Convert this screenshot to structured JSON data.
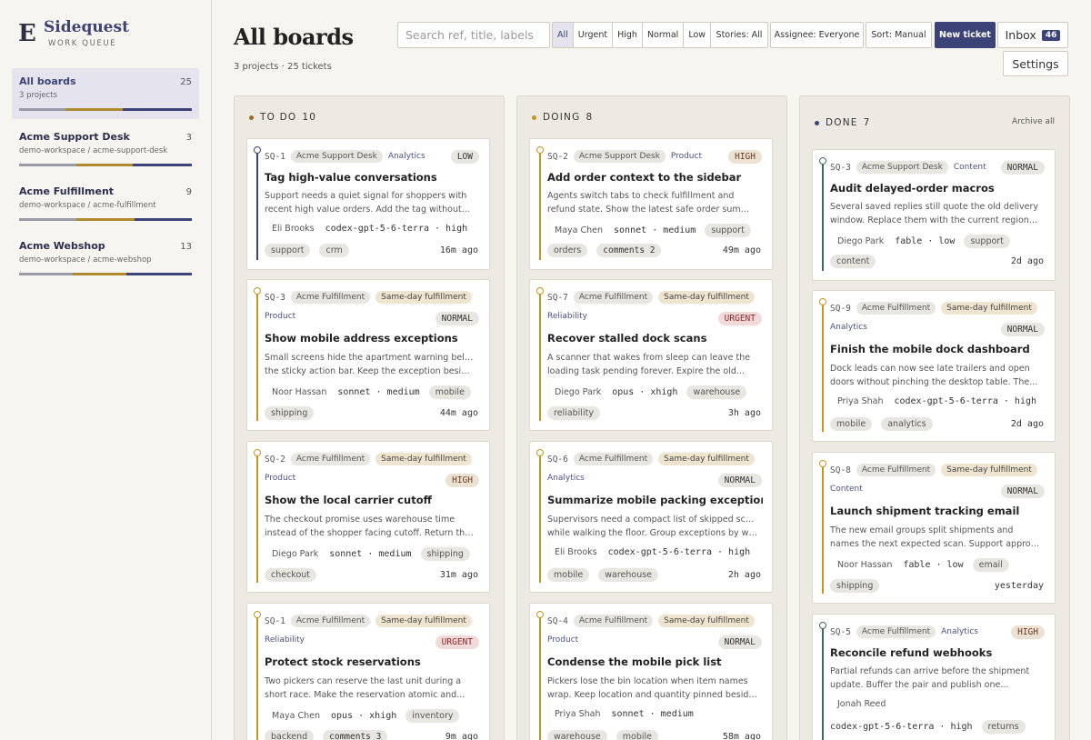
{
  "brand": {
    "name": "Sidequest",
    "subtitle": "WORK QUEUE",
    "mark": "E"
  },
  "sidebar": {
    "projects": [
      {
        "name": "All boards",
        "sub": "3 projects",
        "count": "25"
      },
      {
        "name": "Acme Support Desk",
        "sub": "demo-workspace / acme-support-desk",
        "count": "3"
      },
      {
        "name": "Acme Fulfillment",
        "sub": "demo-workspace / acme-fulfillment",
        "count": "9"
      },
      {
        "name": "Acme Webshop",
        "sub": "demo-workspace / acme-webshop",
        "count": "13"
      }
    ]
  },
  "header": {
    "title": "All boards",
    "subtitle": "3 projects · 25 tickets"
  },
  "toolbar": {
    "search_placeholder": "Search ref, title, labels",
    "filters": [
      "All",
      "Urgent",
      "High",
      "Normal",
      "Low"
    ],
    "stories": "Stories: All",
    "assignee": "Assignee: Everyone",
    "sort": "Sort: Manual",
    "new_ticket": "New ticket",
    "inbox": "Inbox",
    "inbox_count": "46",
    "settings": "Settings"
  },
  "colors": {
    "accent": "#3b4377",
    "todo": "#9a6a1e",
    "doing": "#c8951e",
    "done": "#3f6b52"
  },
  "columns": [
    {
      "title": "TO DO",
      "count": "10",
      "cards": [
        {
          "ref": "SQ-1",
          "project": "Acme Support Desk",
          "kind": "Analytics",
          "priority": "LOW",
          "title": "Tag high-value conversations",
          "desc1": "Support needs a quiet signal for shoppers with",
          "desc2": "recent high value orders. Add the tag without...",
          "assignee": "Eli Brooks",
          "model": "codex-gpt-5-6-terra · high",
          "tags": [
            "support",
            "crm"
          ],
          "ago": "16m ago"
        },
        {
          "ref": "SQ-3",
          "project": "Acme Fulfillment",
          "story": "Same-day fulfillment",
          "kind": "Product",
          "priority": "NORMAL",
          "title": "Show mobile address exceptions",
          "desc1": "Small screens hide the apartment warning below",
          "desc2": "the sticky action bar. Keep the exception beside...",
          "assignee": "Noor Hassan",
          "model": "sonnet · medium",
          "tags": [
            "mobile",
            "shipping"
          ],
          "ago": "44m ago"
        },
        {
          "ref": "SQ-2",
          "project": "Acme Fulfillment",
          "story": "Same-day fulfillment",
          "kind": "Product",
          "priority": "HIGH",
          "title": "Show the local carrier cutoff",
          "desc1": "The checkout promise uses warehouse time",
          "desc2": "instead of the shopper facing cutoff. Return the...",
          "assignee": "Diego Park",
          "model": "sonnet · medium",
          "tags": [
            "shipping",
            "checkout"
          ],
          "ago": "31m ago"
        },
        {
          "ref": "SQ-1",
          "project": "Acme Fulfillment",
          "story": "Same-day fulfillment",
          "kind": "Reliability",
          "priority": "URGENT",
          "title": "Protect stock reservations",
          "desc1": "Two pickers can reserve the last unit during a",
          "desc2": "short race. Make the reservation atomic and...",
          "assignee": "Maya Chen",
          "model": "opus · xhigh",
          "tags": [
            "inventory",
            "backend",
            "comments 3"
          ],
          "ago": "9m ago"
        }
      ]
    },
    {
      "title": "DOING",
      "count": "8",
      "cards": [
        {
          "ref": "SQ-2",
          "project": "Acme Support Desk",
          "kind": "Product",
          "priority": "HIGH",
          "title": "Add order context to the sidebar",
          "desc1": "Agents switch tabs to check fulfillment and",
          "desc2": "refund state. Show the latest safe order summar...",
          "assignee": "Maya Chen",
          "model": "sonnet · medium",
          "tags": [
            "support",
            "orders",
            "comments 2"
          ],
          "ago": "49m ago"
        },
        {
          "ref": "SQ-7",
          "project": "Acme Fulfillment",
          "story": "Same-day fulfillment",
          "kind": "Reliability",
          "priority": "URGENT",
          "title": "Recover stalled dock scans",
          "desc1": "A scanner that wakes from sleep can leave the",
          "desc2": "loading task pending forever. Expire the old...",
          "assignee": "Diego Park",
          "model": "opus · xhigh",
          "tags": [
            "warehouse",
            "reliability"
          ],
          "ago": "3h ago"
        },
        {
          "ref": "SQ-6",
          "project": "Acme Fulfillment",
          "story": "Same-day fulfillment",
          "kind": "Analytics",
          "priority": "NORMAL",
          "title": "Summarize mobile packing exceptions",
          "desc1": "Supervisors need a compact list of skipped scans",
          "desc2": "while walking the floor. Group exceptions by wav...",
          "assignee": "Eli Brooks",
          "model": "codex-gpt-5-6-terra · high",
          "tags": [
            "mobile",
            "warehouse"
          ],
          "ago": "2h ago"
        },
        {
          "ref": "SQ-4",
          "project": "Acme Fulfillment",
          "story": "Same-day fulfillment",
          "kind": "Product",
          "priority": "NORMAL",
          "title": "Condense the mobile pick list",
          "desc1": "Pickers lose the bin location when item names",
          "desc2": "wrap. Keep location and quantity pinned beside...",
          "assignee": "Priya Shah",
          "model": "sonnet · medium",
          "tags": [
            "warehouse",
            "mobile"
          ],
          "ago": "58m ago"
        }
      ]
    },
    {
      "title": "DONE",
      "count": "7",
      "action": "Archive all",
      "cards": [
        {
          "ref": "SQ-3",
          "project": "Acme Support Desk",
          "kind": "Content",
          "priority": "NORMAL",
          "title": "Audit delayed-order macros",
          "desc1": "Several saved replies still quote the old delivery",
          "desc2": "window. Replace them with the current regional...",
          "assignee": "Diego Park",
          "model": "fable · low",
          "tags": [
            "support",
            "content"
          ],
          "ago": "2d ago"
        },
        {
          "ref": "SQ-9",
          "project": "Acme Fulfillment",
          "story": "Same-day fulfillment",
          "kind": "Analytics",
          "priority": "NORMAL",
          "title": "Finish the mobile dock dashboard",
          "desc1": "Dock leads can now see late trailers and open",
          "desc2": "doors without pinching the desktop table. The...",
          "assignee": "Priya Shah",
          "model": "codex-gpt-5-6-terra · high",
          "tags": [
            "mobile",
            "analytics"
          ],
          "ago": "2d ago"
        },
        {
          "ref": "SQ-8",
          "project": "Acme Fulfillment",
          "story": "Same-day fulfillment",
          "kind": "Content",
          "priority": "NORMAL",
          "title": "Launch shipment tracking email",
          "desc1": "The new email groups split shipments and",
          "desc2": "names the next expected scan. Support approve...",
          "assignee": "Noor Hassan",
          "model": "fable · low",
          "tags": [
            "email",
            "shipping"
          ],
          "ago": "yesterday"
        },
        {
          "ref": "SQ-5",
          "project": "Acme Fulfillment",
          "kind": "Analytics",
          "priority": "HIGH",
          "title": "Reconcile refund webhooks",
          "desc1": "Partial refunds can arrive before the shipment",
          "desc2": "update. Buffer the pair and publish one...",
          "assignee": "Jonah Reed",
          "model": "codex-gpt-5-6-terra · high",
          "tags": [
            "returns"
          ],
          "ago": ""
        }
      ]
    }
  ]
}
